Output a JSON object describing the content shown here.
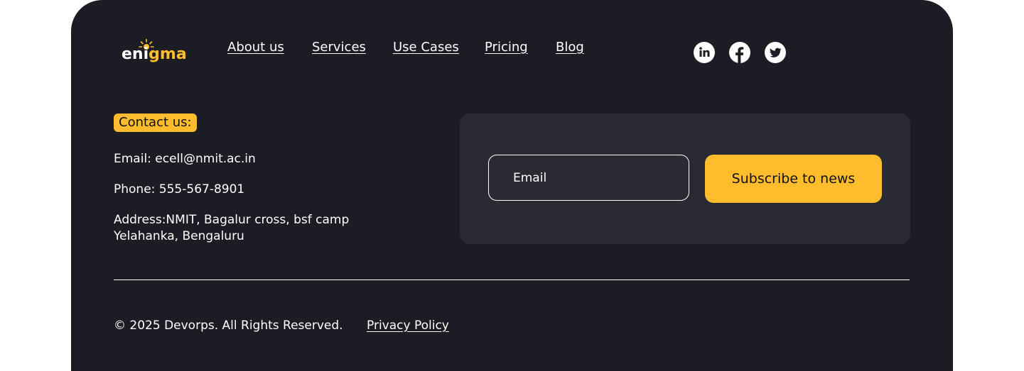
{
  "brand": {
    "logo_text_main": "en",
    "logo_text_i": "i",
    "logo_text_accent": "gma",
    "accent_color": "#ffbd2e",
    "background_color": "#1c1c24"
  },
  "nav": {
    "items": [
      {
        "label": "About us"
      },
      {
        "label": "Services"
      },
      {
        "label": "Use Cases"
      },
      {
        "label": "Pricing"
      },
      {
        "label": "Blog"
      }
    ]
  },
  "social": {
    "icons": [
      "linkedin-icon",
      "facebook-icon",
      "twitter-icon"
    ]
  },
  "contact": {
    "heading": "Contact us:",
    "email": "Email: ecell@nmit.ac.in",
    "phone": "Phone: 555-567-8901",
    "address_line1": "Address:NMIT, Bagalur cross, bsf camp",
    "address_line2": "Yelahanka, Bengaluru"
  },
  "subscribe": {
    "email_placeholder": "Email",
    "button_label": "Subscribe to news"
  },
  "bottom": {
    "copyright": "© 2025 Devorps. All Rights Reserved.",
    "privacy_label": "Privacy Policy"
  }
}
